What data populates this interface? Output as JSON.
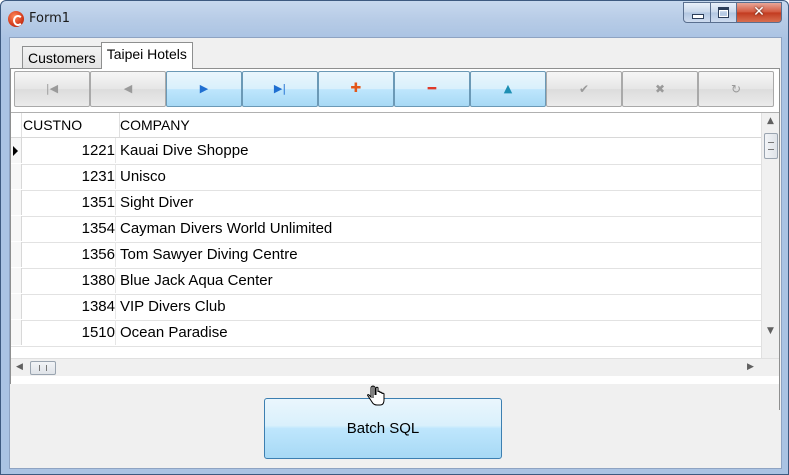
{
  "window": {
    "title": "Form1"
  },
  "tabs": [
    {
      "label": "Customers",
      "active": false
    },
    {
      "label": "Taipei Hotels",
      "active": true
    }
  ],
  "navigator": {
    "buttons": [
      {
        "name": "first",
        "icon": "first-record-icon",
        "glyph": "|◀",
        "enabled": false
      },
      {
        "name": "prior",
        "icon": "prior-record-icon",
        "glyph": "◀",
        "enabled": false
      },
      {
        "name": "next",
        "icon": "next-record-icon",
        "glyph": "▶",
        "enabled": true
      },
      {
        "name": "last",
        "icon": "last-record-icon",
        "glyph": "▶|",
        "enabled": true
      },
      {
        "name": "insert",
        "icon": "insert-record-icon",
        "glyph": "✚",
        "enabled": true
      },
      {
        "name": "delete",
        "icon": "delete-record-icon",
        "glyph": "━",
        "enabled": true
      },
      {
        "name": "edit",
        "icon": "edit-record-icon",
        "glyph": "▲",
        "enabled": true
      },
      {
        "name": "post",
        "icon": "post-edit-icon",
        "glyph": "✔",
        "enabled": false
      },
      {
        "name": "cancel",
        "icon": "cancel-edit-icon",
        "glyph": "✖",
        "enabled": false
      },
      {
        "name": "refresh",
        "icon": "refresh-data-icon",
        "glyph": "↻",
        "enabled": false
      }
    ]
  },
  "grid": {
    "columns": [
      "CUSTNO",
      "COMPANY"
    ],
    "rows": [
      {
        "custno": "1221",
        "company": "Kauai Dive Shoppe",
        "current": true
      },
      {
        "custno": "1231",
        "company": "Unisco",
        "current": false
      },
      {
        "custno": "1351",
        "company": "Sight Diver",
        "current": false
      },
      {
        "custno": "1354",
        "company": "Cayman Divers World Unlimited",
        "current": false
      },
      {
        "custno": "1356",
        "company": "Tom Sawyer Diving Centre",
        "current": false
      },
      {
        "custno": "1380",
        "company": "Blue Jack Aqua Center",
        "current": false
      },
      {
        "custno": "1384",
        "company": "VIP Divers Club",
        "current": false
      },
      {
        "custno": "1510",
        "company": "Ocean Paradise",
        "current": false
      }
    ]
  },
  "batch_button": {
    "label": "Batch SQL"
  },
  "colors": {
    "titlebar": "#b6cbe6",
    "close_button": "#c23a1f",
    "button_hover": "#bee6fd",
    "nav_blue": "#1f6fd1",
    "nav_orange": "#e2571a",
    "nav_red": "#e03a2a",
    "nav_teal": "#1d8fb3"
  }
}
